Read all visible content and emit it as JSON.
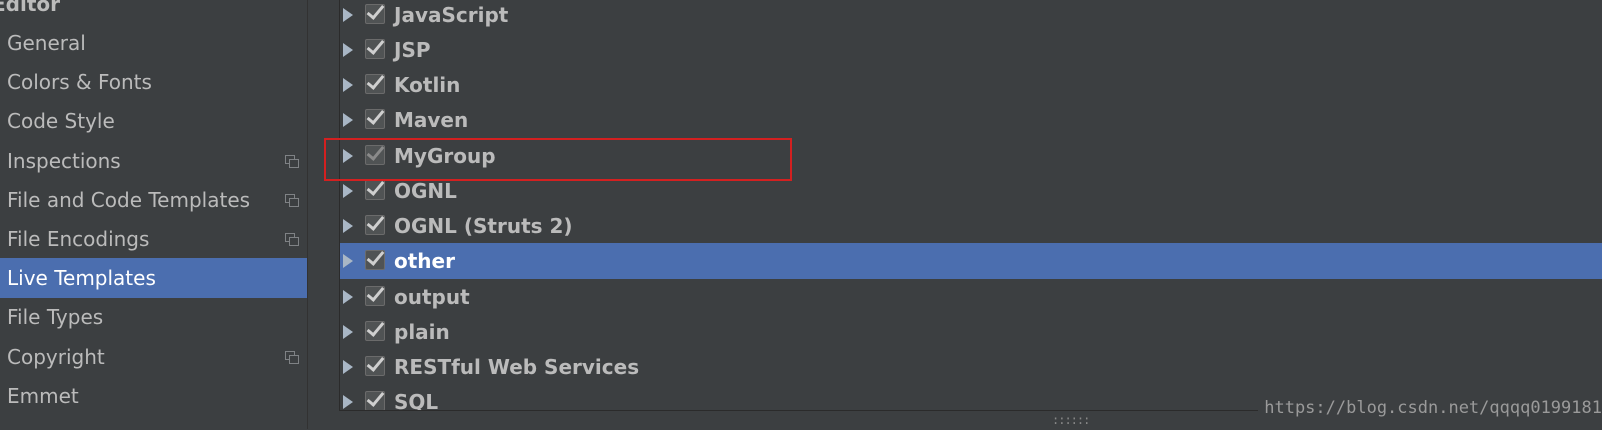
{
  "sidebar": {
    "header": "Editor",
    "items": [
      {
        "label": "General",
        "has_copy_icon": false,
        "selected": false
      },
      {
        "label": "Colors & Fonts",
        "has_copy_icon": false,
        "selected": false
      },
      {
        "label": "Code Style",
        "has_copy_icon": false,
        "selected": false
      },
      {
        "label": "Inspections",
        "has_copy_icon": true,
        "selected": false
      },
      {
        "label": "File and Code Templates",
        "has_copy_icon": true,
        "selected": false
      },
      {
        "label": "File Encodings",
        "has_copy_icon": true,
        "selected": false
      },
      {
        "label": "Live Templates",
        "has_copy_icon": false,
        "selected": true
      },
      {
        "label": "File Types",
        "has_copy_icon": false,
        "selected": false
      },
      {
        "label": "Copyright",
        "has_copy_icon": true,
        "selected": false
      },
      {
        "label": "Emmet",
        "has_copy_icon": false,
        "selected": false
      }
    ]
  },
  "tree": {
    "rows": [
      {
        "label": "JavaScript",
        "checked": true,
        "selected": false,
        "disabled": false
      },
      {
        "label": "JSP",
        "checked": true,
        "selected": false,
        "disabled": false
      },
      {
        "label": "Kotlin",
        "checked": true,
        "selected": false,
        "disabled": false
      },
      {
        "label": "Maven",
        "checked": true,
        "selected": false,
        "disabled": false
      },
      {
        "label": "MyGroup",
        "checked": true,
        "selected": false,
        "disabled": true
      },
      {
        "label": "OGNL",
        "checked": true,
        "selected": false,
        "disabled": false
      },
      {
        "label": "OGNL (Struts 2)",
        "checked": true,
        "selected": false,
        "disabled": false
      },
      {
        "label": "other",
        "checked": true,
        "selected": true,
        "disabled": false
      },
      {
        "label": "output",
        "checked": true,
        "selected": false,
        "disabled": false
      },
      {
        "label": "plain",
        "checked": true,
        "selected": false,
        "disabled": false
      },
      {
        "label": "RESTful Web Services",
        "checked": true,
        "selected": false,
        "disabled": false
      },
      {
        "label": "SQL",
        "checked": true,
        "selected": false,
        "disabled": false
      }
    ]
  },
  "annotation": {
    "highlighted_row": "MyGroup",
    "color": "#d32020"
  },
  "watermark": "https://blog.csdn.net/qqqq0199181",
  "colors": {
    "background": "#3c3f41",
    "selection": "#4b6eaf",
    "text": "#bbbbbb"
  }
}
